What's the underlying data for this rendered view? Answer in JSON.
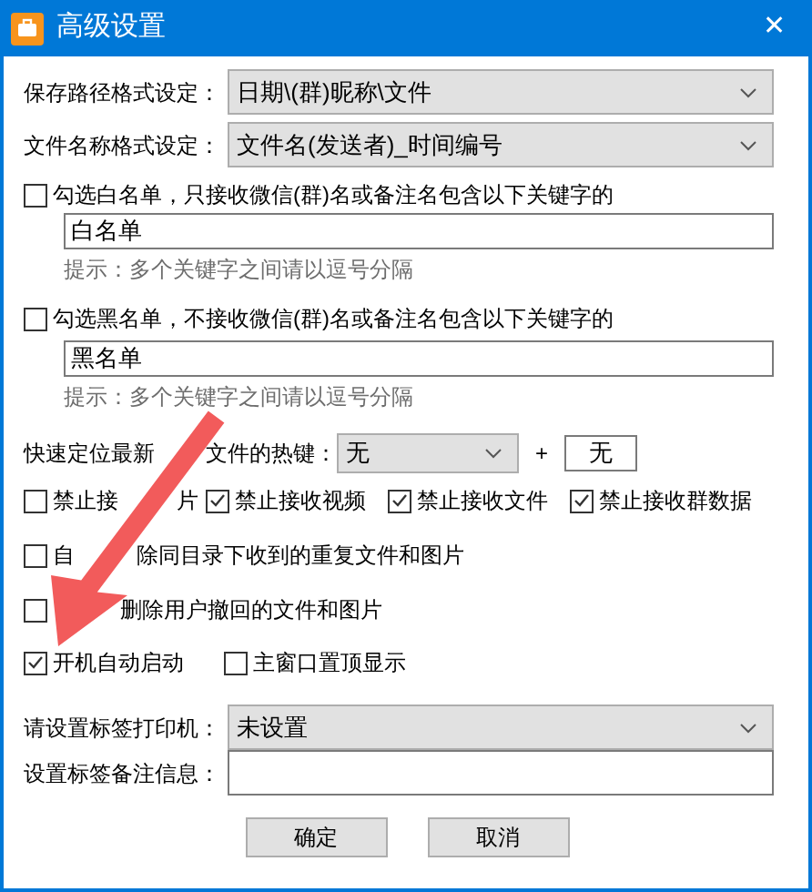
{
  "window": {
    "title": "高级设置",
    "close": "✕"
  },
  "path_format": {
    "label": "保存路径格式设定：",
    "value": "日期\\(群)昵称\\文件"
  },
  "name_format": {
    "label": "文件名称格式设定：",
    "value": "文件名(发送者)_时间编号"
  },
  "whitelist": {
    "label": "勾选白名单，只接收微信(群)名或备注名包含以下关键字的",
    "checked": false,
    "value": "白名单",
    "hint": "提示：多个关键字之间请以逗号分隔"
  },
  "blacklist": {
    "label": "勾选黑名单，不接收微信(群)名或备注名包含以下关键字的",
    "checked": false,
    "value": "黑名单",
    "hint": "提示：多个关键字之间请以逗号分隔"
  },
  "hotkey": {
    "label_parts": [
      "快速定位最新",
      "文件的热键："
    ],
    "modifier": "无",
    "plus": "+",
    "key": "无"
  },
  "options": [
    [
      {
        "label_parts": [
          "禁止接",
          "片"
        ],
        "checked": false
      },
      {
        "label_parts": [
          "禁止接收视频"
        ],
        "checked": true
      },
      {
        "label_parts": [
          "禁止接收文件"
        ],
        "checked": true
      },
      {
        "label_parts": [
          "禁止接收群数据"
        ],
        "checked": true
      }
    ],
    [
      {
        "label_parts": [
          "自",
          "除同目录下收到的重复文件和图片"
        ],
        "checked": false
      }
    ],
    [
      {
        "label_parts": [
          "删除用户撤回的文件和图片"
        ],
        "checked": false
      }
    ],
    [
      {
        "label_parts": [
          "开机自动启动"
        ],
        "checked": true
      },
      {
        "label_parts": [
          "主窗口置顶显示"
        ],
        "checked": false
      }
    ]
  ],
  "printer": {
    "label": "请设置标签打印机：",
    "value": "未设置"
  },
  "remark": {
    "label": "设置标签备注信息："
  },
  "buttons": [
    "确定",
    "取消"
  ]
}
